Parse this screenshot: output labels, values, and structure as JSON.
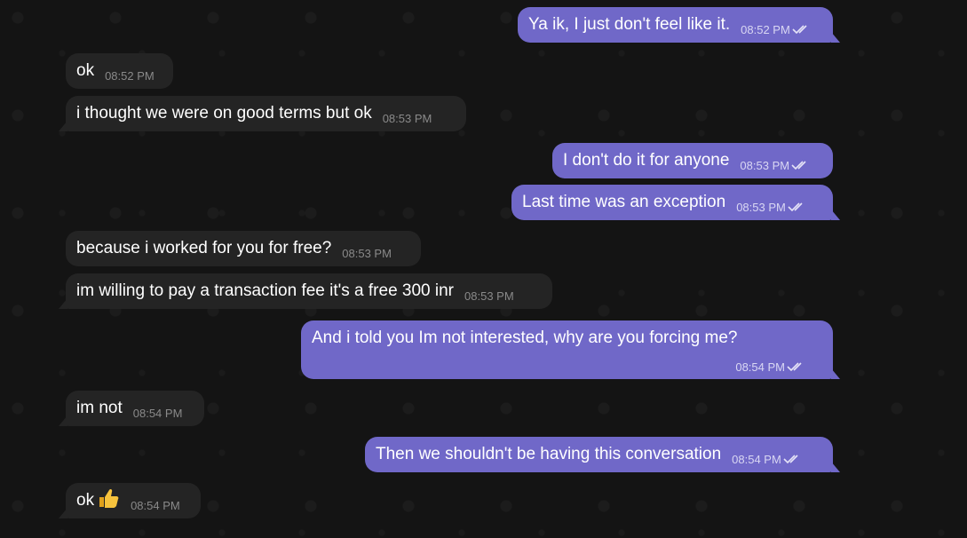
{
  "chat": {
    "messages": [
      {
        "dir": "out",
        "text": "Ya ik, I just don't feel like it.",
        "time": "08:52 PM"
      },
      {
        "dir": "in",
        "text": "ok",
        "time": "08:52 PM"
      },
      {
        "dir": "in",
        "text": "i thought we were on good terms but ok",
        "time": "08:53 PM"
      },
      {
        "dir": "out",
        "text": "I don't do it for anyone",
        "time": "08:53 PM"
      },
      {
        "dir": "out",
        "text": "Last time was an exception",
        "time": "08:53 PM"
      },
      {
        "dir": "in",
        "text": "because i worked for you for free?",
        "time": "08:53 PM"
      },
      {
        "dir": "in",
        "text": "im willing to pay a transaction fee it's a free 300 inr",
        "time": "08:53 PM"
      },
      {
        "dir": "out",
        "text": "And i told you Im not interested, why are you forcing me?",
        "time": "08:54 PM"
      },
      {
        "dir": "in",
        "text": "im not",
        "time": "08:54 PM"
      },
      {
        "dir": "out",
        "text": "Then we shouldn't be having this conversation",
        "time": "08:54 PM"
      },
      {
        "dir": "in",
        "text": "ok",
        "time": "08:54 PM",
        "emoji": "thumbs-up-emoji"
      }
    ]
  },
  "colors": {
    "background": "#141414",
    "incoming_bubble": "#242424",
    "outgoing_bubble": "#7068c8"
  },
  "icons": {
    "read_receipt": "double-check-icon"
  }
}
